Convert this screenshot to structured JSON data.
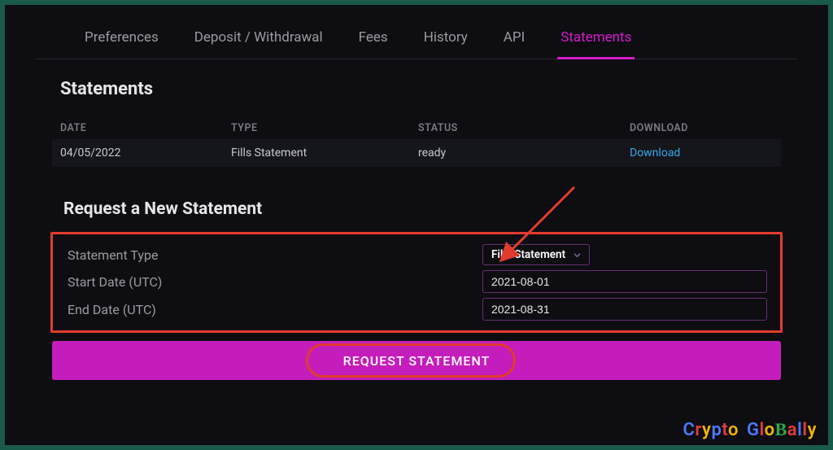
{
  "tabs": {
    "preferences": "Preferences",
    "deposit": "Deposit / Withdrawal",
    "fees": "Fees",
    "history": "History",
    "api": "API",
    "statements": "Statements"
  },
  "page_title": "Statements",
  "table": {
    "headers": {
      "date": "DATE",
      "type": "TYPE",
      "status": "STATUS",
      "download": "DOWNLOAD"
    },
    "rows": [
      {
        "date": "04/05/2022",
        "type": "Fills Statement",
        "status": "ready",
        "download": "Download"
      }
    ]
  },
  "request": {
    "title": "Request a New Statement",
    "labels": {
      "statement_type": "Statement Type",
      "start_date": "Start Date (UTC)",
      "end_date": "End Date (UTC)"
    },
    "values": {
      "statement_type": "Fills Statement",
      "start_date": "2021-08-01",
      "end_date": "2021-08-31"
    },
    "button": "REQUEST STATEMENT"
  },
  "watermark": {
    "text": "Crypto GloBally"
  }
}
